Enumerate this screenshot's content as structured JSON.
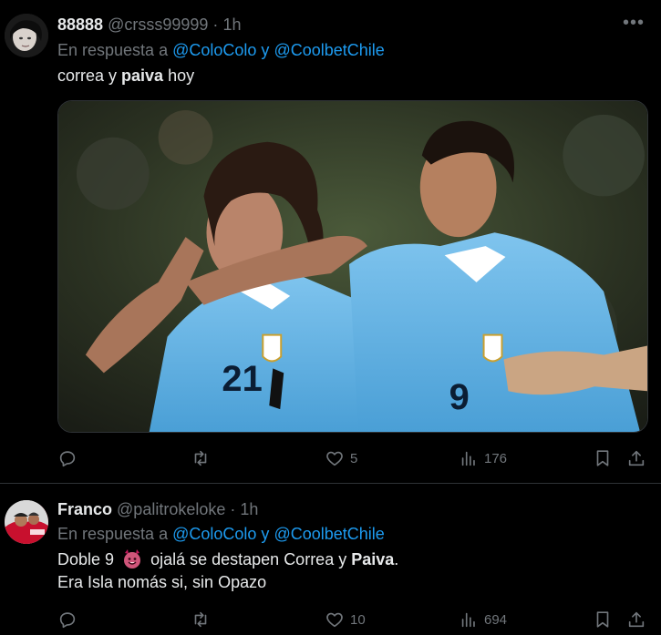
{
  "tweets": [
    {
      "display_name": "88888",
      "handle": "@crsss99999",
      "separator": "·",
      "time": "1h",
      "reply_prefix": "En respuesta a",
      "mentions": [
        "@ColoColo",
        "@CoolbetChile"
      ],
      "mention_joiner": "y",
      "text_parts": [
        "correa y ",
        "paiva",
        " hoy"
      ],
      "stats": {
        "replies": "",
        "retweets": "",
        "likes": "5",
        "views": "176"
      },
      "media_description_icon": "football-players-photo"
    },
    {
      "display_name": "Franco",
      "handle": "@palitrokeloke",
      "separator": "·",
      "time": "1h",
      "reply_prefix": "En respuesta a",
      "mentions": [
        "@ColoColo",
        "@CoolbetChile"
      ],
      "mention_joiner": "y",
      "line1_parts": [
        "Doble 9",
        "ojalá se destapen Correa y ",
        "Paiva",
        "."
      ],
      "line2": "Era Isla nomás si, sin Opazo",
      "stats": {
        "replies": "",
        "retweets": "",
        "likes": "10",
        "views": "694"
      }
    }
  ],
  "more_icon": "•••",
  "colors": {
    "background": "#000000",
    "text": "#e7e9ea",
    "muted": "#71767b",
    "accent": "#1d9bf0",
    "divider": "#2f3336"
  }
}
